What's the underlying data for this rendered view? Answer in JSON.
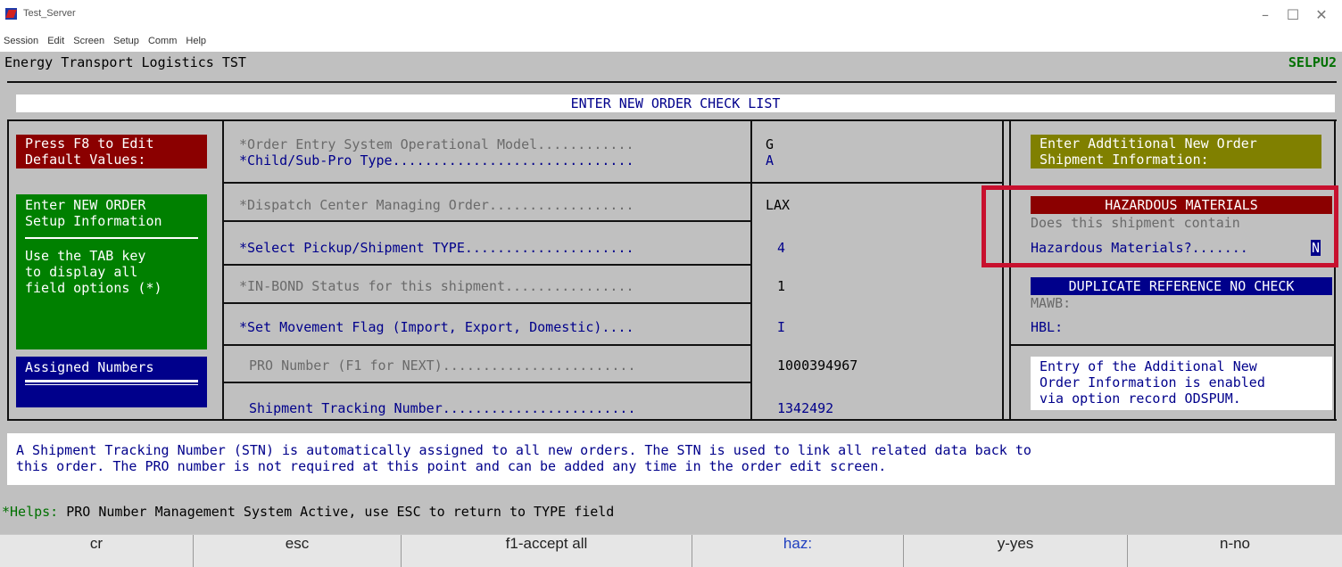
{
  "window": {
    "title": "Test_Server",
    "menu": [
      "Session",
      "Edit",
      "Screen",
      "Setup",
      "Comm",
      "Help"
    ],
    "minimize": "–",
    "maximize": "☐",
    "close": "✕"
  },
  "header": {
    "app_name": "Energy Transport Logistics TST",
    "screen_id": "SELPU2"
  },
  "checklist_title": "ENTER NEW ORDER CHECK LIST",
  "left": {
    "f8_lines": [
      "Press F8 to Edit",
      "Default Values:"
    ],
    "setup_lines": [
      "Enter NEW ORDER",
      "Setup Information"
    ],
    "tab_lines": [
      "Use the TAB key",
      "to display all",
      "field options (*)"
    ],
    "assigned_label": "Assigned Numbers"
  },
  "fields": [
    {
      "label": "*Order Entry System Operational Model............",
      "value": "G"
    },
    {
      "label": "*Child/Sub-Pro Type..............................",
      "value": "A"
    },
    {
      "label": "*Dispatch Center Managing Order..................",
      "value": "LAX"
    },
    {
      "label": "*Select Pickup/Shipment TYPE.....................",
      "value": "4"
    },
    {
      "label": "*IN-BOND Status for this shipment................",
      "value": "1"
    },
    {
      "label": "*Set Movement Flag (Import, Export, Domestic)....",
      "value": "I"
    },
    {
      "label": "PRO Number (F1 for NEXT)........................",
      "value": "1000394967"
    },
    {
      "label": "Shipment Tracking Number........................",
      "value": "1342492"
    }
  ],
  "right": {
    "additional_lines": [
      "Enter Addtitional New Order",
      "Shipment Information:"
    ],
    "haz_title": "HAZARDOUS MATERIALS",
    "haz_question1": "Does this shipment contain",
    "haz_question2": "Hazardous Materials?.......",
    "haz_value": "N",
    "dup_title": "DUPLICATE REFERENCE NO CHECK",
    "mawb_label": "MAWB:",
    "hbl_label": "HBL:",
    "info_lines": [
      "Entry of the Additional New",
      "Order Information is enabled",
      "via option record ODSPUM."
    ]
  },
  "notice_lines": [
    "A Shipment Tracking Number (STN) is automatically assigned to all new orders.  The STN is used to link all related data back to",
    "this order.  The PRO number is not required at this point and can be added any time in the order edit screen."
  ],
  "helps": {
    "prefix": "*Helps:",
    "text": "PRO Number Management System Active, use ESC to return to TYPE field"
  },
  "function_keys": [
    "cr",
    "esc",
    "f1-accept all",
    "haz:",
    "y-yes",
    "n-no"
  ],
  "colors": {
    "screen_bg": "#c0c0c0",
    "dark_red": "#8b0000",
    "green": "#008000",
    "navy": "#00008b",
    "olive": "#808000",
    "highlight_red": "#c8102e"
  }
}
